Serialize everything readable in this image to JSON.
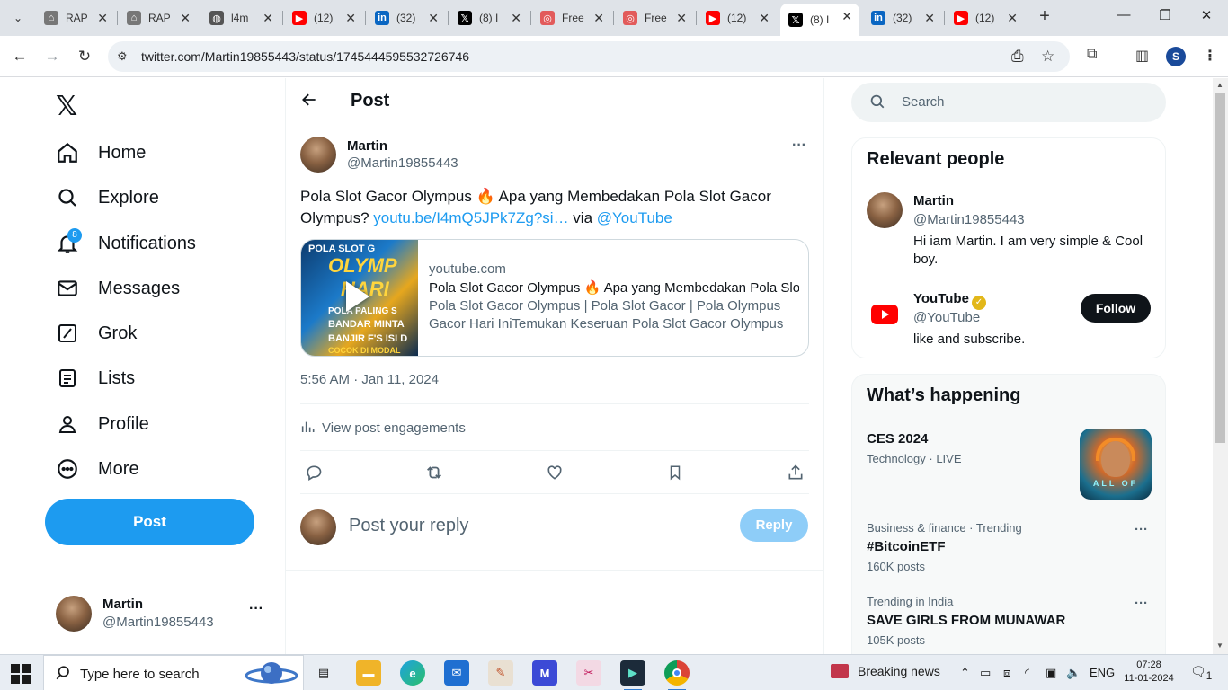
{
  "browser": {
    "tabs": [
      {
        "title": "RAP",
        "favicon": "rap-icon",
        "color": "#777777"
      },
      {
        "title": "RAP",
        "favicon": "rap-icon",
        "color": "#777777"
      },
      {
        "title": "l4m",
        "favicon": "globe-icon",
        "color": "#555555"
      },
      {
        "title": "(12)",
        "favicon": "youtube-icon",
        "color": "#ff0000"
      },
      {
        "title": "(32)",
        "favicon": "linkedin-icon",
        "color": "#0a66c2"
      },
      {
        "title": "(8) I",
        "favicon": "x-icon",
        "color": "#000000"
      },
      {
        "title": "Free",
        "favicon": "free-icon",
        "color": "#e25b5b"
      },
      {
        "title": "Free",
        "favicon": "free-icon",
        "color": "#e25b5b"
      },
      {
        "title": "(12)",
        "favicon": "youtube-icon",
        "color": "#ff0000"
      },
      {
        "title": "(8) I",
        "favicon": "x-icon",
        "color": "#000000",
        "active": true
      },
      {
        "title": "(32)",
        "favicon": "linkedin-icon",
        "color": "#0a66c2"
      },
      {
        "title": "(12)",
        "favicon": "youtube-icon",
        "color": "#ff0000"
      }
    ],
    "url": "twitter.com/Martin19855443/status/1745444595532726746",
    "profile_initial": "S"
  },
  "sidebar": {
    "nav": [
      {
        "label": "Home",
        "icon": "home-icon"
      },
      {
        "label": "Explore",
        "icon": "search-icon"
      },
      {
        "label": "Notifications",
        "icon": "bell-icon",
        "badge": "8"
      },
      {
        "label": "Messages",
        "icon": "mail-icon"
      },
      {
        "label": "Grok",
        "icon": "grok-icon"
      },
      {
        "label": "Lists",
        "icon": "list-icon"
      },
      {
        "label": "Profile",
        "icon": "person-icon"
      },
      {
        "label": "More",
        "icon": "more-circle-icon"
      }
    ],
    "post_label": "Post",
    "account": {
      "name": "Martin",
      "handle": "@Martin19855443",
      "more": "···"
    }
  },
  "main": {
    "title": "Post",
    "tweet": {
      "name": "Martin",
      "handle": "@Martin19855443",
      "text_before": "Pola Slot Gacor Olympus 🔥 Apa yang Membedakan Pola Slot Gacor Olympus? ",
      "link_text": "youtu.be/I4mQ5JPk7Zg?si…",
      "text_via": " via ",
      "mention": "@YouTube",
      "card": {
        "domain": "youtube.com",
        "title": "Pola Slot Gacor Olympus 🔥 Apa yang Membedakan Pola Slot Gacor",
        "description": "Pola Slot Gacor Olympus | Pola Slot Gacor | Pola Olympus Gacor Hari IniTemukan Keseruan Pola Slot Gacor Olympus dalam...",
        "thumb_lines": [
          "POLA SLOT G",
          "OLYMP",
          "HARI",
          "POLA PALING S",
          "BANDAR MINTA",
          "BANJIR F'S ISI D",
          "COCOK DI MODAL"
        ]
      },
      "time": "5:56 AM · Jan 11, 2024",
      "engagements": "View post engagements"
    },
    "reply": {
      "placeholder": "Post your reply",
      "button": "Reply"
    }
  },
  "right": {
    "search_placeholder": "Search",
    "relevant": {
      "title": "Relevant people",
      "people": [
        {
          "name": "Martin",
          "handle": "@Martin19855443",
          "bio": "Hi iam Martin. I am very simple & Cool boy."
        },
        {
          "name": "YouTube",
          "handle": "@YouTube",
          "bio": "like and subscribe.",
          "follow": "Follow",
          "verified": "✓"
        }
      ]
    },
    "happening": {
      "title": "What’s happening",
      "trends": [
        {
          "name": "CES 2024",
          "meta": "Technology · LIVE",
          "image_text": "ALL OF"
        },
        {
          "meta": "Business & finance · Trending",
          "name": "#BitcoinETF",
          "count": "160K posts"
        },
        {
          "meta": "Trending in India",
          "name": "SAVE GIRLS FROM MUNAWAR",
          "count": "105K posts"
        }
      ]
    }
  },
  "taskbar": {
    "search_text": "Type here to search",
    "news": "Breaking news",
    "lang": "ENG",
    "time": "07:28",
    "date": "11-01-2024",
    "notif_count": "1"
  }
}
